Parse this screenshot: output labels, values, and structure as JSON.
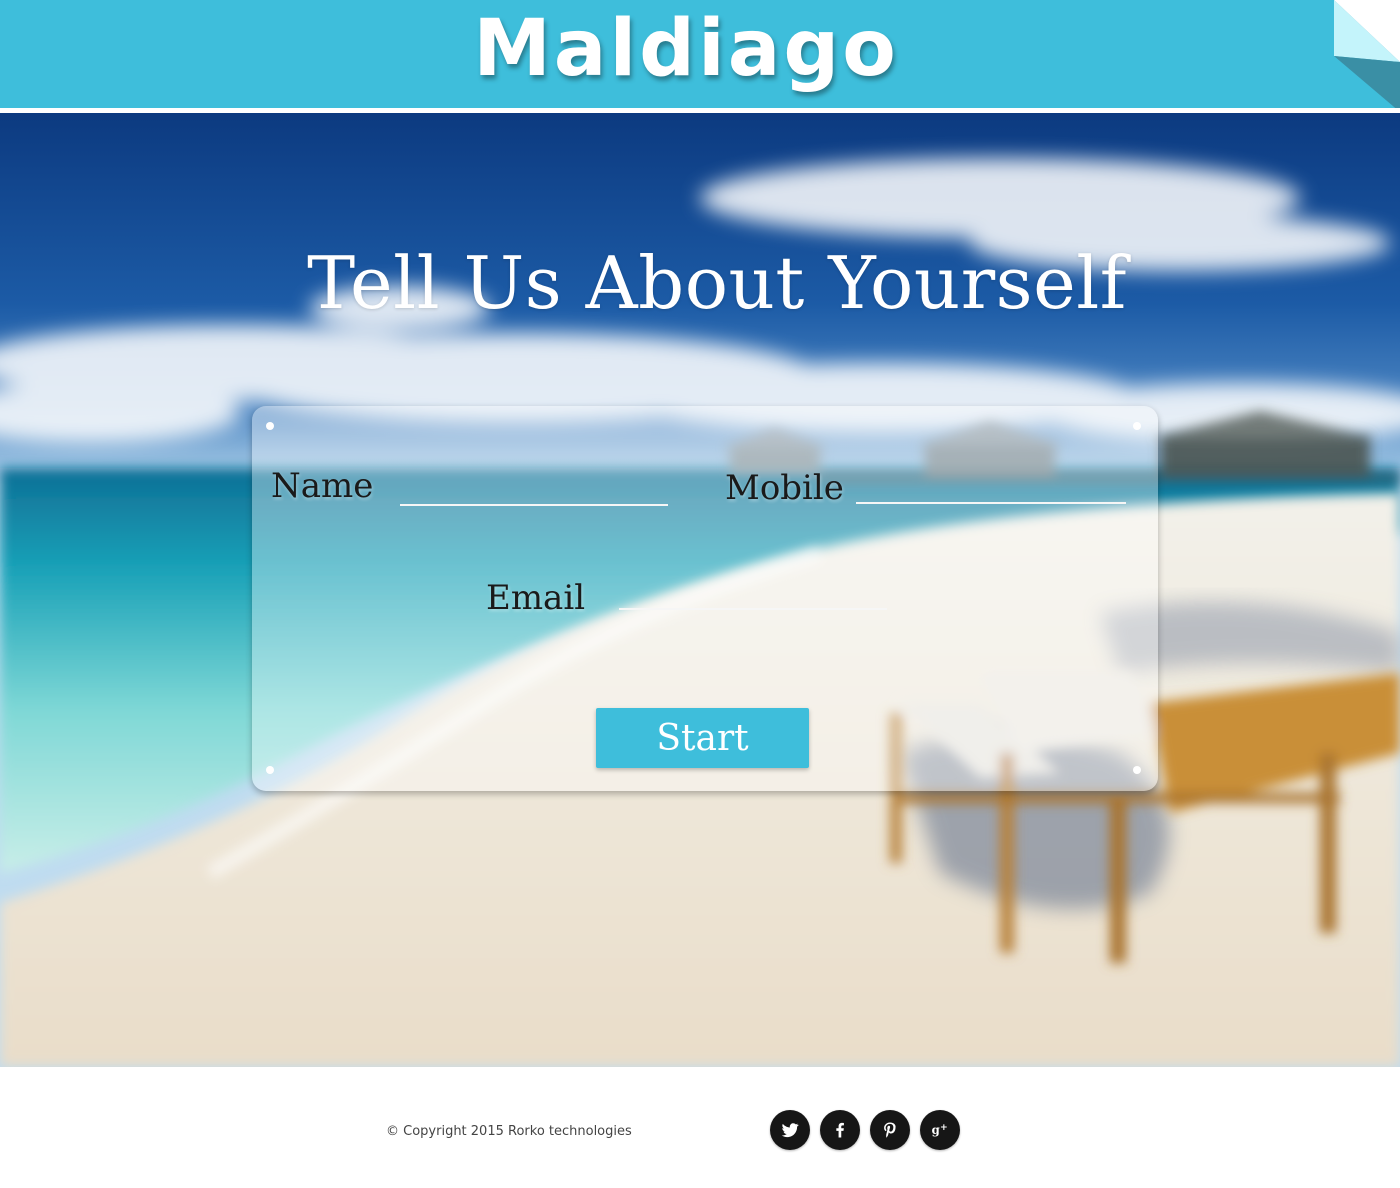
{
  "header": {
    "brand": "Maldiago"
  },
  "hero": {
    "title": "Tell Us About Yourself"
  },
  "form": {
    "name_label": "Name",
    "name_value": "",
    "mobile_label": "Mobile",
    "mobile_value": "",
    "email_label": "Email",
    "email_value": "",
    "start_label": "Start"
  },
  "footer": {
    "copyright": "© Copyright 2015 Rorko technologies",
    "social": [
      {
        "icon": "twitter-icon"
      },
      {
        "icon": "facebook-icon"
      },
      {
        "icon": "pinterest-icon"
      },
      {
        "icon": "google-plus-icon"
      }
    ]
  },
  "colors": {
    "accent": "#3ebedb",
    "social_background": "#161616",
    "text_dark": "#1a1a1a"
  }
}
